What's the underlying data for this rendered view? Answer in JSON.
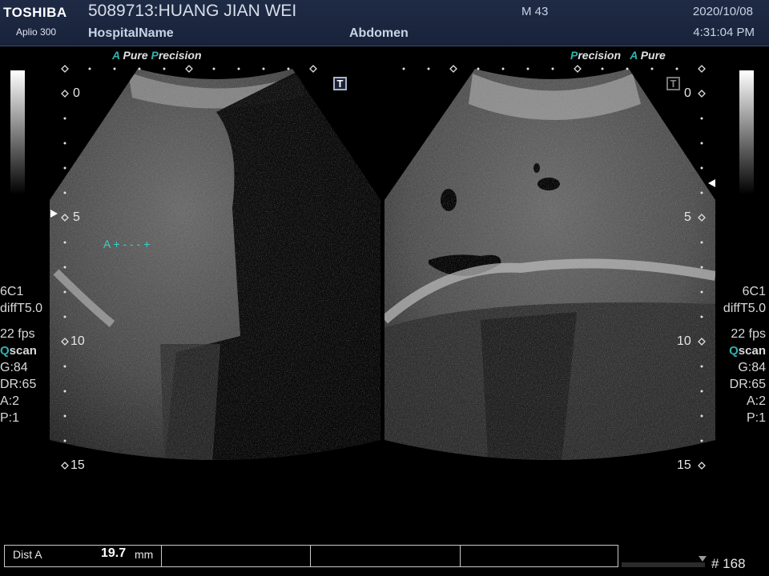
{
  "header": {
    "brand": "TOSHIBA",
    "model": "Aplio 300",
    "patient": "5089713:HUANG JIAN WEI",
    "hospital": "HospitalName",
    "exam": "Abdomen",
    "mi": "M 43",
    "date": "2020/10/08",
    "time": "4:31:04 PM"
  },
  "left_image": {
    "label_a": "A",
    "label_pure": "Pure",
    "label_p": "P",
    "label_precision": "recision",
    "depth_marks": [
      "0",
      "5",
      "10",
      "15"
    ],
    "caliper_label": "A",
    "caliper_marks": "+ - - - +"
  },
  "right_image": {
    "label_p": "P",
    "label_precision": "recision",
    "label_a": "A",
    "label_pure": "Pure",
    "depth_marks": [
      "0",
      "5",
      "10",
      "15"
    ]
  },
  "left_params": {
    "probe": "6C1",
    "mode": "diffT5.0",
    "fps": "22 fps",
    "qscan_q": "Q",
    "qscan_rest": "scan",
    "gain": "G:84",
    "dr": "DR:65",
    "a": "A:2",
    "p": "P:1"
  },
  "right_params": {
    "probe": "6C1",
    "mode": "diffT5.0",
    "fps": "22 fps",
    "qscan_q": "Q",
    "qscan_rest": "scan",
    "gain": "G:84",
    "dr": "DR:65",
    "a": "A:2",
    "p": "P:1"
  },
  "measurement": {
    "label": "Dist A",
    "value": "19.7",
    "unit": "mm"
  },
  "frame_number": "# 168",
  "icons": {
    "left_t": "T",
    "right_t": "T"
  }
}
